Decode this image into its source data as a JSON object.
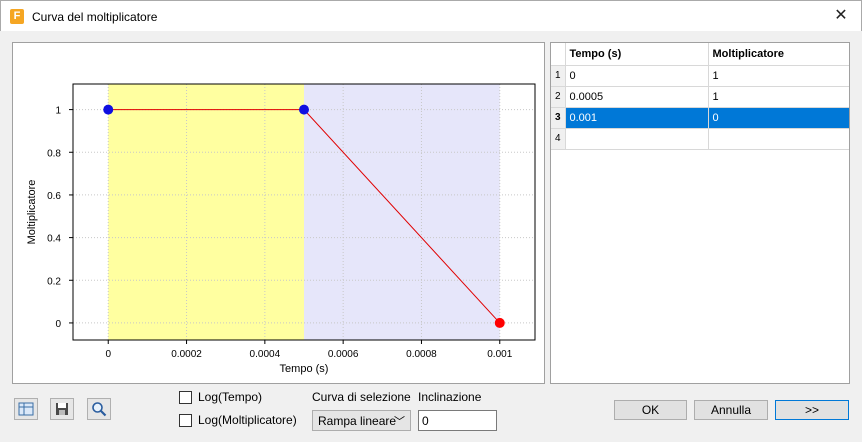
{
  "window": {
    "title": "Curva del moltiplicatore",
    "app_icon_letter": "F",
    "close_glyph": "✕"
  },
  "chart_data": {
    "type": "line",
    "xlabel": "Tempo (s)",
    "ylabel": "Moltiplicatore",
    "x_ticks": [
      "0",
      "0.0002",
      "0.0004",
      "0.0006",
      "0.0008",
      "0.001"
    ],
    "y_ticks": [
      "0",
      "0.2",
      "0.4",
      "0.6",
      "0.8",
      "1"
    ],
    "xlim": [
      -9e-05,
      0.00109
    ],
    "ylim": [
      -0.08,
      1.12
    ],
    "grid": true,
    "regions": [
      {
        "from": 0,
        "to": 0.0005,
        "color": "#ffffa0"
      },
      {
        "from": 0.0005,
        "to": 0.001,
        "color": "#e6e6fa"
      }
    ],
    "series": [
      {
        "x": [
          0,
          0.0005,
          0.001
        ],
        "y": [
          1,
          1,
          0
        ],
        "line_color": "#e00000",
        "point_colors": [
          "#1010e0",
          "#1010e0",
          "#ff0000"
        ]
      }
    ]
  },
  "table": {
    "headers": [
      "Tempo (s)",
      "Moltiplicatore"
    ],
    "rows": [
      {
        "num": "1",
        "tempo": "0",
        "moltiplicatore": "1",
        "selected": false
      },
      {
        "num": "2",
        "tempo": "0.0005",
        "moltiplicatore": "1",
        "selected": false
      },
      {
        "num": "3",
        "tempo": "0.001",
        "moltiplicatore": "0",
        "selected": true
      },
      {
        "num": "4",
        "tempo": "",
        "moltiplicatore": "",
        "selected": false
      }
    ]
  },
  "toolbar": {
    "icons": [
      "table-icon",
      "save-icon",
      "zoom-icon"
    ]
  },
  "options": {
    "log_tempo_label": "Log(Tempo)",
    "log_moltiplicatore_label": "Log(Moltiplicatore)",
    "curve_label": "Curva di selezione",
    "curve_value": "Rampa lineare",
    "slope_label": "Inclinazione",
    "slope_value": "0"
  },
  "buttons": {
    "ok": "OK",
    "cancel": "Annulla",
    "more": ">>"
  }
}
